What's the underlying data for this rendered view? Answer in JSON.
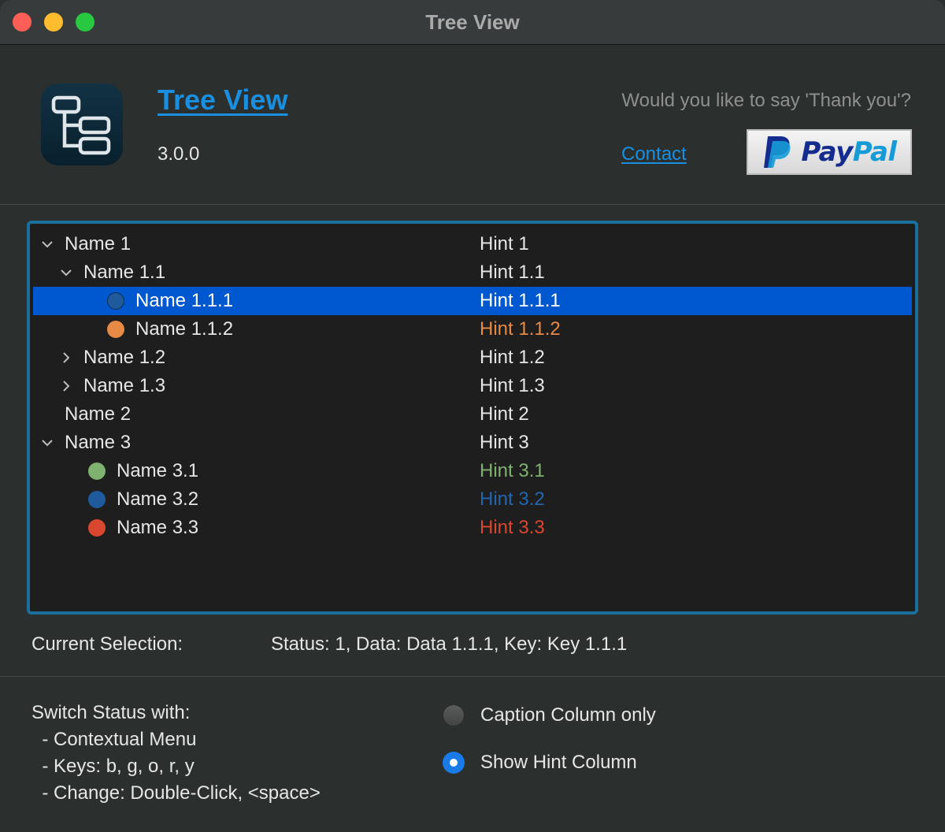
{
  "window": {
    "title": "Tree View"
  },
  "header": {
    "app_name": "Tree View",
    "version": "3.0.0",
    "thanks_prompt": "Would you like to say 'Thank you'?",
    "contact_label": "Contact",
    "paypal_pay": "Pay",
    "paypal_pal": "Pal"
  },
  "tree": {
    "rows": [
      {
        "name": "Name 1",
        "hint": "Hint 1"
      },
      {
        "name": "Name 1.1",
        "hint": "Hint 1.1"
      },
      {
        "name": "Name 1.1.1",
        "hint": "Hint 1.1.1"
      },
      {
        "name": "Name 1.1.2",
        "hint": "Hint 1.1.2"
      },
      {
        "name": "Name 1.2",
        "hint": "Hint 1.2"
      },
      {
        "name": "Name 1.3",
        "hint": "Hint 1.3"
      },
      {
        "name": "Name 2",
        "hint": "Hint 2"
      },
      {
        "name": "Name 3",
        "hint": "Hint 3"
      },
      {
        "name": "Name 3.1",
        "hint": "Hint 3.1"
      },
      {
        "name": "Name 3.2",
        "hint": "Hint 3.2"
      },
      {
        "name": "Name 3.3",
        "hint": "Hint 3.3"
      }
    ],
    "status_colors": {
      "blue": "#1f5a9c",
      "orange": "#e68a45",
      "green": "#7fb26e",
      "red": "#d9472f"
    },
    "selection_color": "#0058d0"
  },
  "status": {
    "label": "Current Selection:",
    "value": "Status: 1, Data: Data 1.1.1, Key: Key 1.1.1"
  },
  "help": {
    "lines": [
      "Switch Status with:",
      "  - Contextual Menu",
      "  - Keys: b, g, o, r, y",
      "  - Change: Double-Click, <space>"
    ]
  },
  "options": {
    "caption_only": "Caption Column only",
    "show_hint": "Show Hint Column",
    "selected": "Show Hint Column"
  }
}
